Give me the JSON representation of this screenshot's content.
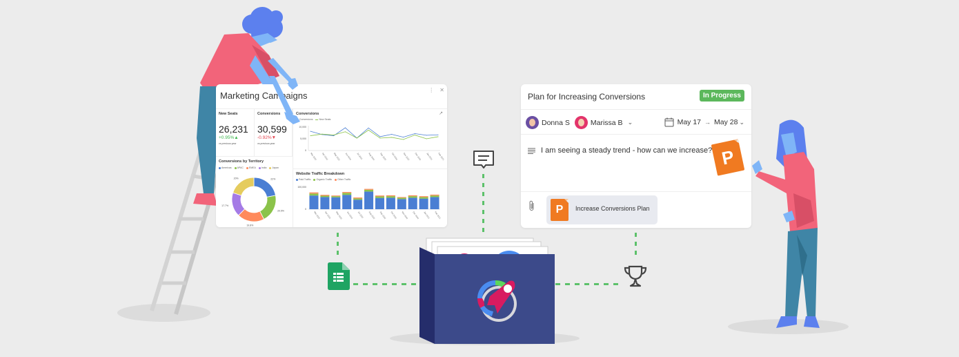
{
  "marketing_card": {
    "title": "Marketing Campaigns",
    "menu_icon": "more-vertical-icon",
    "close_icon": "close-icon",
    "kpis": [
      {
        "label": "New Seats",
        "value": "26,231",
        "delta": "+0.95%",
        "direction": "up",
        "sub": "vs previous year"
      },
      {
        "label": "Conversions",
        "value": "30,599",
        "delta": "-0.92%",
        "direction": "down",
        "sub": "vs previous year"
      }
    ],
    "expand_icon": "expand-icon"
  },
  "plan_card": {
    "title": "Plan for Increasing Conversions",
    "status": "In Progress",
    "status_color": "#5cb85c",
    "assignees": [
      {
        "name": "Donna S",
        "ring_color": "#6a4fa3"
      },
      {
        "name": "Marissa B",
        "ring_color": "#e3346b"
      }
    ],
    "start_date": "May 17",
    "arrow": "→",
    "end_date": "May 28",
    "message": "I am seeing a steady trend - how can we increase?",
    "attachment": {
      "name": "Increase Conversions Plan",
      "icon": "P"
    }
  },
  "floating_icons": {
    "comment": "comment-icon",
    "sheets": "google-sheets-icon",
    "trophy": "trophy-icon",
    "held_document": "P"
  },
  "colors": {
    "background": "#ececec",
    "connector": "#5cc16a",
    "box": "#3c4a8a",
    "box_side": "#252d6b",
    "ppt_orange": "#f07a21",
    "shirt": "#f2647a",
    "skin": "#7fb5f7",
    "hair": "#5c80ee",
    "pants": "#3f85a6"
  },
  "chart_data": [
    {
      "type": "line",
      "title": "Conversions",
      "series": [
        {
          "name": "Conversions",
          "color": "#4a7ed3",
          "values": [
            8200,
            6800,
            6300,
            9700,
            5300,
            9600,
            5900,
            6900,
            5700,
            7200,
            6500,
            6700
          ]
        },
        {
          "name": "New Seats",
          "color": "#8bc34a",
          "values": [
            6300,
            7000,
            6600,
            8000,
            5300,
            8700,
            5300,
            5600,
            4700,
            6600,
            5000,
            5900
          ]
        }
      ],
      "categories": [
        "Mar 2020",
        "Apr 2020",
        "May 2020",
        "Jun 2020",
        "Jul 2020",
        "Aug 2020",
        "Sep 2020",
        "Oct 2020",
        "Nov 2020",
        "Dec 2020",
        "Jan 2021",
        "Feb 2021"
      ],
      "yticks": [
        "10,000",
        "5,000",
        "0"
      ],
      "ylim": [
        0,
        10000
      ]
    },
    {
      "type": "pie",
      "title": "Conversions by Territory",
      "categories": [
        "Americas",
        "APAC",
        "EMEA",
        "India",
        "Japan"
      ],
      "values": [
        22,
        20.5,
        19.8,
        17.7,
        20
      ],
      "labels": [
        "22%",
        "20.5%",
        "19.8%",
        "17.7%",
        "20%"
      ],
      "colors": [
        "#4a7ed3",
        "#8bc34a",
        "#ff8a5c",
        "#a57be6",
        "#e5cc5e"
      ]
    },
    {
      "type": "bar",
      "title": "Website Traffic Breakdown",
      "series": [
        {
          "name": "Paid Traffic",
          "color": "#4a7ed3",
          "values": [
            62,
            55,
            54,
            65,
            43,
            80,
            51,
            52,
            46,
            52,
            48,
            55
          ]
        },
        {
          "name": "Organic Traffic",
          "color": "#8bc34a",
          "values": [
            9,
            6,
            5,
            9,
            6,
            8,
            7,
            7,
            6,
            7,
            7,
            7
          ]
        },
        {
          "name": "Other Traffic",
          "color": "#ff8a5c",
          "values": [
            5,
            4,
            3,
            4,
            4,
            4,
            4,
            4,
            3,
            4,
            4,
            4
          ]
        }
      ],
      "categories": [
        "Mar 2020",
        "Apr 2020",
        "May 2020",
        "Jun 2020",
        "Jul 2020",
        "Aug 2020",
        "Sep 2020",
        "Oct 2020",
        "Nov 2020",
        "Dec 2020",
        "Jan 2021",
        "Feb 2021"
      ],
      "yticks": [
        "100,000",
        "0"
      ],
      "ylim": [
        0,
        100
      ],
      "stacked": true
    }
  ]
}
